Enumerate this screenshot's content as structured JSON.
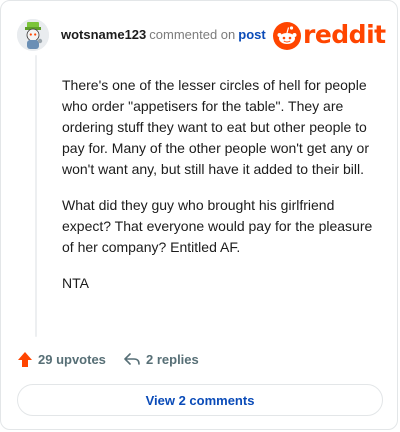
{
  "comment": {
    "username": "wotsname123",
    "commented_text": "commented on",
    "post_link": "post",
    "paragraphs": [
      "There's one of the lesser circles of hell for people who order \"appetisers for the table\". They are ordering stuff they want to eat but other people to pay for. Many of the other people won't get any or won't want any, but still have it added to their bill.",
      "What did they guy who brought his girlfriend expect? That everyone would pay for the pleasure of her company? Entitled AF.",
      "NTA"
    ]
  },
  "brand": {
    "logo_text": "reddit",
    "icon": "reddit-snoo-icon",
    "color": "#ff4500"
  },
  "actions": {
    "upvotes_label": "29 upvotes",
    "upvote_icon": "upvote-arrow-icon",
    "replies_label": "2 replies",
    "reply_icon": "reply-arrow-icon"
  },
  "view_comments_label": "View 2 comments",
  "colors": {
    "link": "#0a4bb8",
    "accent": "#ff4500",
    "muted": "#576f76"
  }
}
